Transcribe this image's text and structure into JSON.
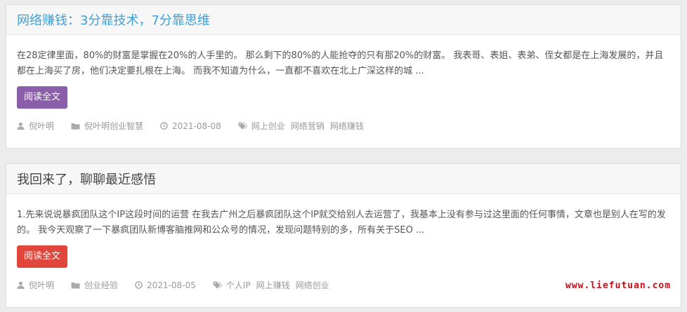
{
  "posts": [
    {
      "title": "网络赚钱：3分靠技术，7分靠思维",
      "excerpt": "在28定律里面，80%的财富是掌握在20%的人手里的。 那么剩下的80%的人能抢夺的只有那20%的财富。 我表哥、表姐、表弟、侄女都是在上海发展的，并且都在上海买了房，他们决定要扎根在上海。 而我不知道为什么，一直都不喜欢在北上广深这样的城 ...",
      "button": "阅读全文",
      "author": "倪叶明",
      "category": "倪叶明创业智慧",
      "date": "2021-08-08",
      "tags": [
        "网上创业",
        "网络营销",
        "网络赚钱"
      ]
    },
    {
      "title": "我回来了，聊聊最近感悟",
      "excerpt": "1.先来说说暴疯团队这个IP这段时间的运营 在我去广州之后暴疯团队这个IP就交给别人去运营了，我基本上没有参与过这里面的任何事情，文章也是别人在写的发的。 我今天观察了一下暴疯团队新博客脑推网和公众号的情况，发现问题特别的多，所有关于SEO ...",
      "button": "阅读全文",
      "author": "倪叶明",
      "category": "创业经验",
      "date": "2021-08-05",
      "tags": [
        "个人IP",
        "网上赚钱",
        "网络创业"
      ]
    }
  ],
  "watermark": "www.liefutuan.com",
  "colors": {
    "title_link": "#3ea0d6",
    "button_purple": "#8a5ea8",
    "button_red": "#e0463c",
    "watermark": "#c4101b"
  },
  "icons": {
    "author": "user-icon",
    "category": "folder-icon",
    "date": "clock-icon",
    "tags": "tags-icon"
  }
}
